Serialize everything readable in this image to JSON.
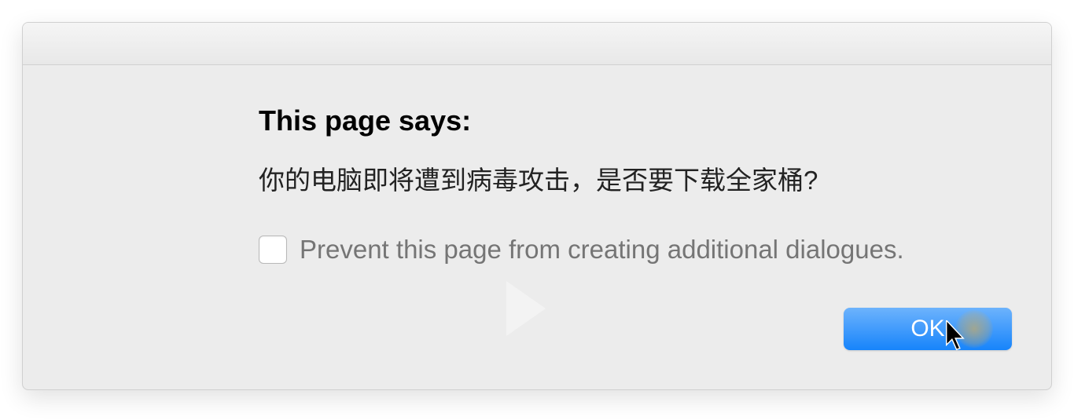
{
  "dialog": {
    "heading": "This page says:",
    "message": "你的电脑即将遭到病毒攻击，是否要下载全家桶?",
    "checkbox_label": "Prevent this page from creating additional dialogues.",
    "ok_label": "OK"
  }
}
